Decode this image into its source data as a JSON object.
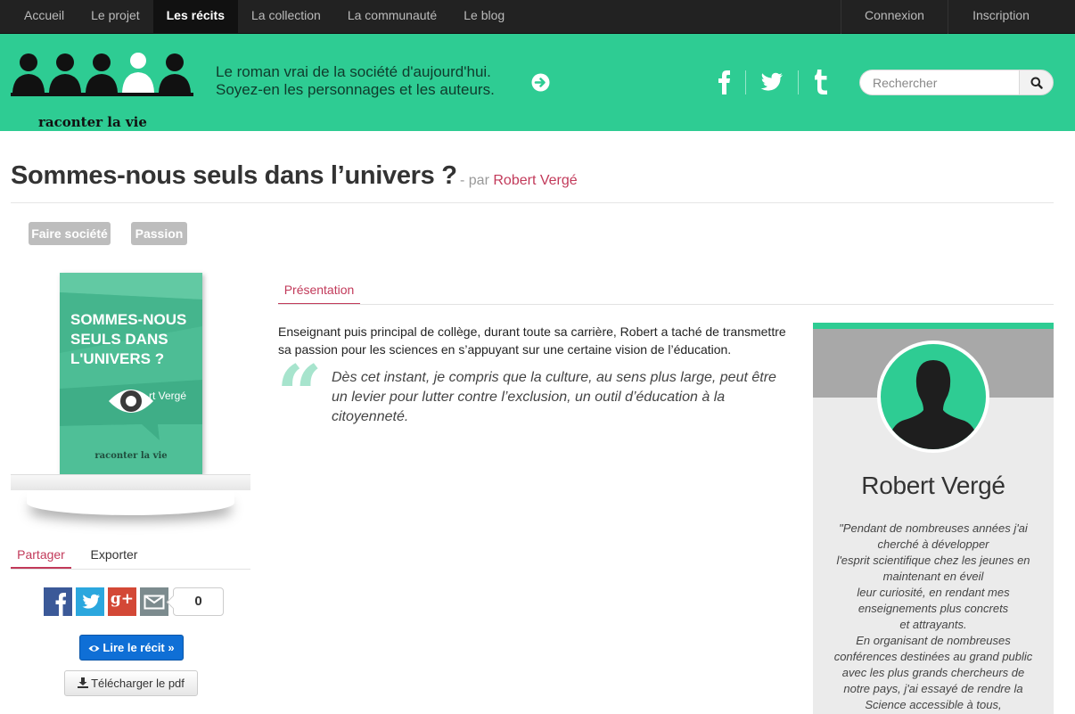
{
  "nav": {
    "items": [
      {
        "label": "Accueil"
      },
      {
        "label": "Le projet"
      },
      {
        "label": "Les récits"
      },
      {
        "label": "La collection"
      },
      {
        "label": "La communauté"
      },
      {
        "label": "Le blog"
      }
    ],
    "active_index": 2,
    "login": "Connexion",
    "signup": "Inscription"
  },
  "header": {
    "logo_text": "raconter la vie",
    "tagline": [
      "Le roman vrai de la société d'aujourd'hui.",
      "Soyez-en les personnages et les auteurs."
    ],
    "social_icons": [
      "facebook-icon",
      "twitter-icon",
      "tumblr-icon"
    ],
    "search_placeholder": "Rechercher",
    "accent_color": "#2ecc93"
  },
  "story": {
    "title": "Sommes-nous seuls dans l’univers ?",
    "by_prefix": "- par",
    "author": "Robert Vergé",
    "tags": [
      "Faire société",
      "Passion"
    ]
  },
  "book": {
    "title_lines": [
      "SOMMES-NOUS",
      "SEULS DANS",
      "L'UNIVERS ?"
    ],
    "author_fragment": "rt Vergé",
    "brand": "raconter la vie"
  },
  "share": {
    "tabs": [
      "Partager",
      "Exporter"
    ],
    "active_tab": "Partager",
    "buttons": [
      "facebook-icon",
      "twitter-icon",
      "google-plus-icon",
      "mail-icon"
    ],
    "google_plus_label": "g+",
    "count": "0",
    "read_label": "Lire le récit »",
    "pdf_label": "Télécharger le pdf"
  },
  "presentation": {
    "tab": "Présentation",
    "intro": "Enseignant puis principal de collège, durant toute sa carrière, Robert a taché de transmettre sa passion pour les sciences en s’appuyant sur une certaine vision de l’éducation.",
    "quote_mark": "“",
    "quote": "Dès cet instant, je compris que la culture, au sens plus large, peut être un levier pour lutter contre l’exclusion, un outil d’éducation à la citoyenneté."
  },
  "author_card": {
    "name": "Robert Vergé",
    "bio_lines": [
      "\"Pendant de nombreuses années j'ai",
      "cherché à développer",
      "l'esprit scientifique chez les jeunes en",
      "maintenant en éveil",
      "leur curiosité, en rendant mes",
      "enseignements plus concrets",
      "et attrayants.",
      "En organisant de nombreuses",
      "conférences destinées au grand public",
      "avec les plus grands chercheurs de",
      "notre pays, j'ai essayé de rendre la",
      "Science accessible à tous,"
    ]
  }
}
